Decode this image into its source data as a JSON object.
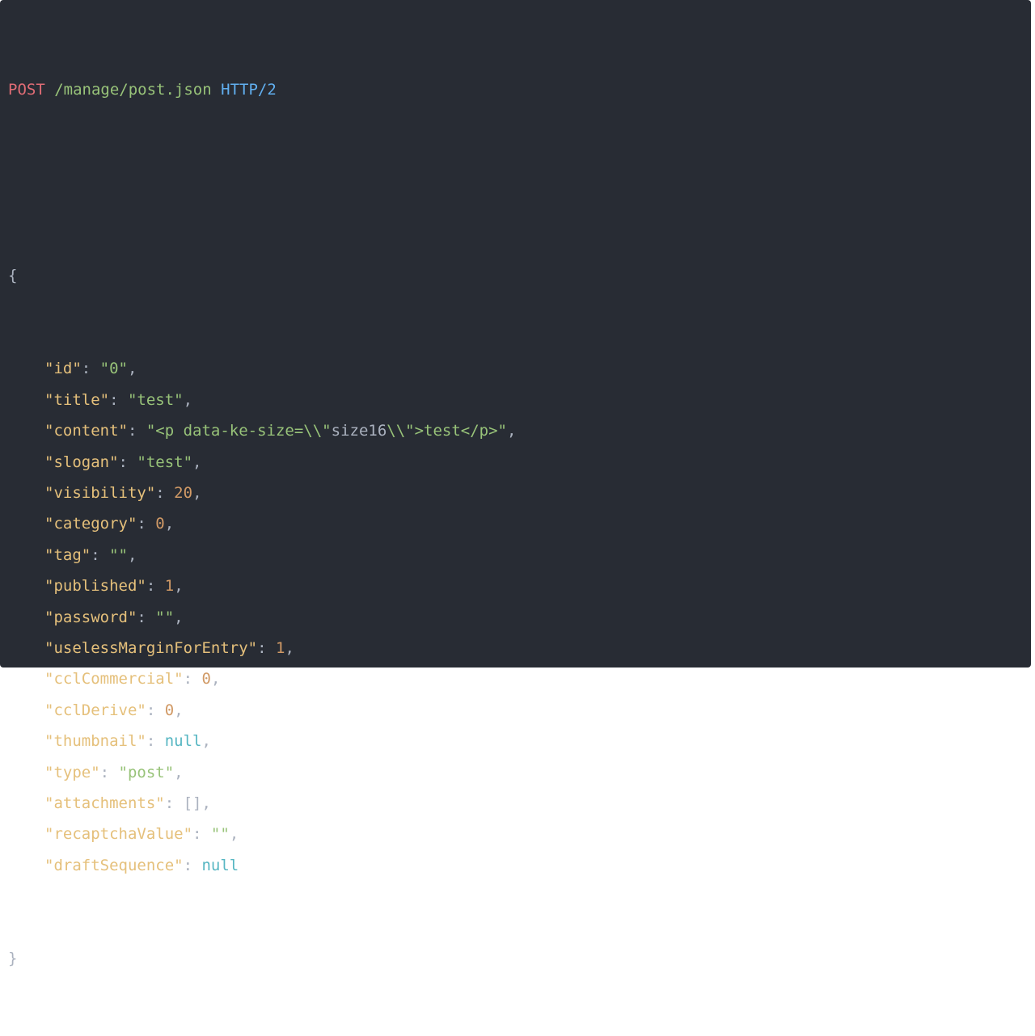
{
  "colors": {
    "background": "#282c34",
    "method": "#e06c75",
    "path": "#98c379",
    "protocol": "#61afef",
    "key": "#e5c07b",
    "string": "#98c379",
    "number": "#d19a66",
    "null": "#56b6c2",
    "punctuation": "#abb2bf"
  },
  "request": {
    "method": "POST",
    "path": "/manage/post.json",
    "protocol": "HTTP/2"
  },
  "body": {
    "open": "{",
    "close": "}",
    "fields": [
      {
        "key": "\"id\"",
        "sep": ": ",
        "value": "\"0\"",
        "type": "string",
        "comma": ","
      },
      {
        "key": "\"title\"",
        "sep": ": ",
        "value": "\"test\"",
        "type": "string",
        "comma": ","
      },
      {
        "key": "\"content\"",
        "sep": ": ",
        "value_parts": [
          "\"<p data-ke-size=\\\\\"",
          "size16",
          "\\\\\">test</p>\""
        ],
        "type": "content",
        "comma": ","
      },
      {
        "key": "\"slogan\"",
        "sep": ": ",
        "value": "\"test\"",
        "type": "string",
        "comma": ","
      },
      {
        "key": "\"visibility\"",
        "sep": ": ",
        "value": "20",
        "type": "number",
        "comma": ","
      },
      {
        "key": "\"category\"",
        "sep": ": ",
        "value": "0",
        "type": "number",
        "comma": ","
      },
      {
        "key": "\"tag\"",
        "sep": ": ",
        "value": "\"\"",
        "type": "string",
        "comma": ","
      },
      {
        "key": "\"published\"",
        "sep": ": ",
        "value": "1",
        "type": "number",
        "comma": ","
      },
      {
        "key": "\"password\"",
        "sep": ": ",
        "value": "\"\"",
        "type": "string",
        "comma": ","
      },
      {
        "key": "\"uselessMarginForEntry\"",
        "sep": ": ",
        "value": "1",
        "type": "number",
        "comma": ","
      },
      {
        "key": "\"cclCommercial\"",
        "sep": ": ",
        "value": "0",
        "type": "number",
        "comma": ","
      },
      {
        "key": "\"cclDerive\"",
        "sep": ": ",
        "value": "0",
        "type": "number",
        "comma": ","
      },
      {
        "key": "\"thumbnail\"",
        "sep": ": ",
        "value": "null",
        "type": "null",
        "comma": ","
      },
      {
        "key": "\"type\"",
        "sep": ": ",
        "value": "\"post\"",
        "type": "string",
        "comma": ","
      },
      {
        "key": "\"attachments\"",
        "sep": ": ",
        "value": "[]",
        "type": "punct",
        "comma": ","
      },
      {
        "key": "\"recaptchaValue\"",
        "sep": ": ",
        "value": "\"\"",
        "type": "string",
        "comma": ","
      },
      {
        "key": "\"draftSequence\"",
        "sep": ": ",
        "value": "null",
        "type": "null",
        "comma": ""
      }
    ]
  }
}
